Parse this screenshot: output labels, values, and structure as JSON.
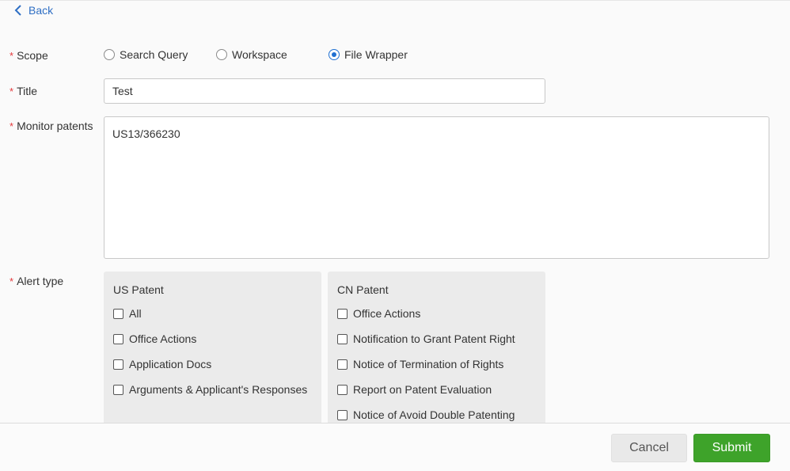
{
  "nav": {
    "back_label": "Back"
  },
  "form": {
    "required_mark": "*",
    "scope": {
      "label": "Scope",
      "options": [
        {
          "label": "Search Query",
          "checked": false
        },
        {
          "label": "Workspace",
          "checked": false
        },
        {
          "label": "File Wrapper",
          "checked": true
        }
      ]
    },
    "title": {
      "label": "Title",
      "value": "Test"
    },
    "monitor": {
      "label": "Monitor patents",
      "value": "US13/366230"
    },
    "alert_type": {
      "label": "Alert type",
      "us": {
        "title": "US Patent",
        "items": [
          "All",
          "Office Actions",
          "Application Docs",
          "Arguments & Applicant's Responses"
        ]
      },
      "cn": {
        "title": "CN Patent",
        "items": [
          "Office Actions",
          "Notification to Grant Patent Right",
          "Notice of Termination of Rights",
          "Report on Patent Evaluation",
          "Notice of Avoid Double Patenting"
        ]
      }
    }
  },
  "footer": {
    "cancel_label": "Cancel",
    "submit_label": "Submit"
  },
  "colors": {
    "accent": "#1f6fd1",
    "link": "#2f6fc4",
    "required": "#e4393c",
    "submit": "#3ea32a"
  }
}
